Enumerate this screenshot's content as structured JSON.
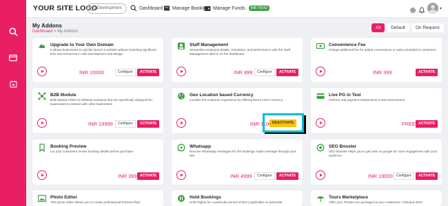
{
  "topbar": {
    "logo": "YOUR SITE LOGO",
    "environment": "Development",
    "nav": {
      "dashboard": "Dashboard",
      "manage_booking": "Manage Booking",
      "manage_funds": "Manage Funds",
      "funds_badge": "INR 70143"
    }
  },
  "page": {
    "title": "My Addons",
    "breadcrumb_home": "Dashboard",
    "breadcrumb_sep": " > ",
    "breadcrumb_current": "My Addons"
  },
  "filters": [
    "All",
    "Default",
    "On Request"
  ],
  "cards": {
    "c1": {
      "title": "Upgrade to Your Own Domain",
      "desc": "It allows businesses to quickly launch a website without investing significant time and resources in web development and design.",
      "price": "INR 10000",
      "configure": "Configure",
      "action": "ACTIVATE"
    },
    "c2": {
      "title": "Staff Management",
      "desc": "Streamline employee details, schedules, and performance with the Staff Management add-on on the dashboard",
      "price": "INR 899",
      "configure": "Configure",
      "action": "ACTIVATE"
    },
    "c3": {
      "title": "Convenience Fee",
      "desc": "Charge additional fee for added convenience or value provided to customers.",
      "price": "INR 399",
      "action": "ACTIVATE"
    },
    "c4": {
      "title": "B2B Module",
      "desc": "B2B Module refers to software solutions that are specifically designed for businesses to interact with other businesses",
      "price": "INR 19999",
      "configure": "Configure",
      "action": "ACTIVATE"
    },
    "c5": {
      "title": "Geo Location based Currency",
      "desc": "Localize the customer experience by offering fees in their currency.",
      "price": "INR 1100",
      "action": "DEACTIVATE"
    },
    "c6": {
      "title": "Live PG in Test",
      "desc": "Perform real payment transactions in test environment",
      "price": "FREE",
      "action": "ACTIVATE"
    },
    "c7": {
      "title": "Booking Preview",
      "desc": "Let your customers review booking details before purchase.",
      "price": "INR 399",
      "action": "ACTIVATE"
    },
    "c8": {
      "title": "Whatsapp",
      "desc": "Receive Whatsapp messages for the bookings made message through your site.",
      "price": "INR 4999",
      "configure": "Configure",
      "action": "ACTIVATE"
    },
    "c9": {
      "title": "SEO Booster",
      "desc": "SEO Booster helps you to get rank on google for more engagement with your audience.",
      "price": "INR 19000",
      "configure": "Configure",
      "action": "ACTIVATE"
    },
    "c10": {
      "title": "Photo Editor",
      "desc": "This photo editor allows you to create professional Runtouu flyer"
    },
    "c11": {
      "title": "Hold Bookings",
      "desc": "Hold Flights for a particular period of time (Applicable on particular"
    },
    "c12": {
      "title": "Tours Marketplace",
      "desc": "Offer your Private tour packages to your customers. Onboard other"
    }
  },
  "colors": {
    "accent": "#e91e63",
    "highlight": "#00bcd4",
    "deactivate": "#ffc107"
  }
}
